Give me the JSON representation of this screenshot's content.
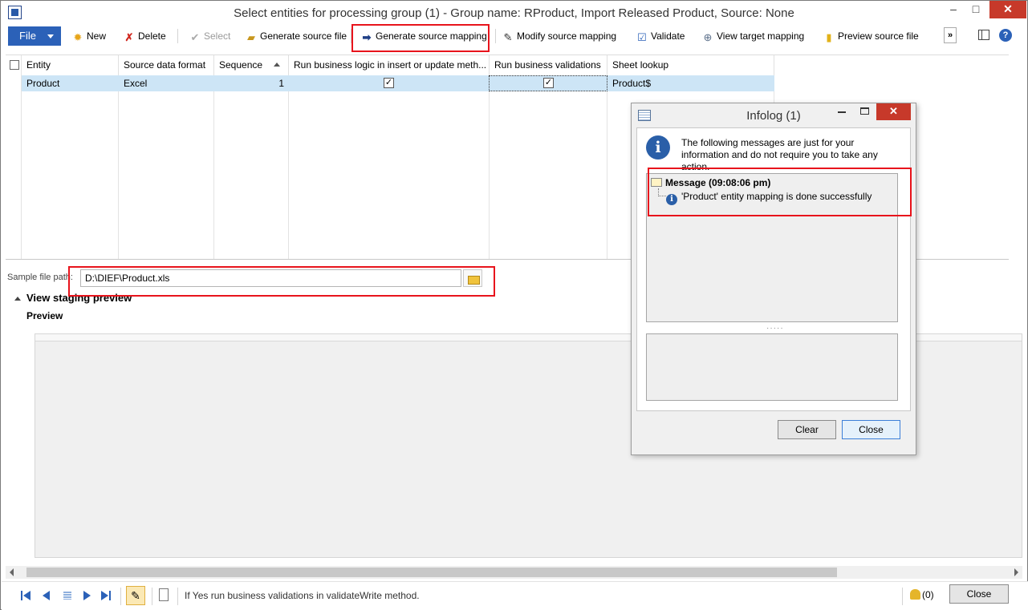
{
  "window": {
    "title": "Select entities for processing group (1) - Group name: RProduct, Import Released Product, Source: None",
    "min_glyph": "–",
    "max_glyph": "□",
    "close_glyph": "✕"
  },
  "toolbar": {
    "file": "File",
    "new": "New",
    "delete": "Delete",
    "select": "Select",
    "generate_source_file": "Generate source file",
    "generate_source_mapping": "Generate source mapping",
    "modify_source_mapping": "Modify source mapping",
    "validate": "Validate",
    "view_target_mapping": "View target mapping",
    "preview_source_file": "Preview source file",
    "more": "»",
    "help": "?"
  },
  "grid": {
    "columns": [
      "Entity",
      "Source data format",
      "Sequence",
      "Run business logic in insert or update meth...",
      "Run business validations",
      "Sheet lookup"
    ],
    "rows": [
      {
        "entity": "Product",
        "source_format": "Excel",
        "sequence": "1",
        "run_business_logic": "✓",
        "run_business_validations": "✓",
        "sheet_lookup": "Product$"
      }
    ]
  },
  "sample_file": {
    "label": "Sample file path:",
    "value": "D:\\DIEF\\Product.xls"
  },
  "staging": {
    "title": "View staging preview",
    "preview_label": "Preview"
  },
  "statusbar": {
    "message": "If Yes run business validations in validateWrite method.",
    "notifications": "(0)",
    "close": "Close"
  },
  "infolog": {
    "title": "Infolog (1)",
    "close_glyph": "✕",
    "intro": "The following messages are just for your information and do not require you to take any action.",
    "message_header": "Message (09:08:06 pm)",
    "message_item": "'Product' entity mapping is done successfully",
    "splitter": "·····",
    "clear_button": "Clear",
    "close_button": "Close"
  },
  "colors": {
    "accent": "#2b61b8",
    "selection": "#cde5f6",
    "highlight_box": "#e8141c",
    "close_red": "#c7392a"
  },
  "icons": {
    "new": "sun-star-icon",
    "delete": "red-x-icon",
    "select": "check-icon",
    "generate_source_file": "folder-edit-icon",
    "generate_source_mapping": "arrow-right-icon",
    "modify_source_mapping": "pen-icon",
    "validate": "checkbox-icon",
    "view_target_mapping": "map-view-icon",
    "preview_source_file": "cylinder-icon"
  }
}
